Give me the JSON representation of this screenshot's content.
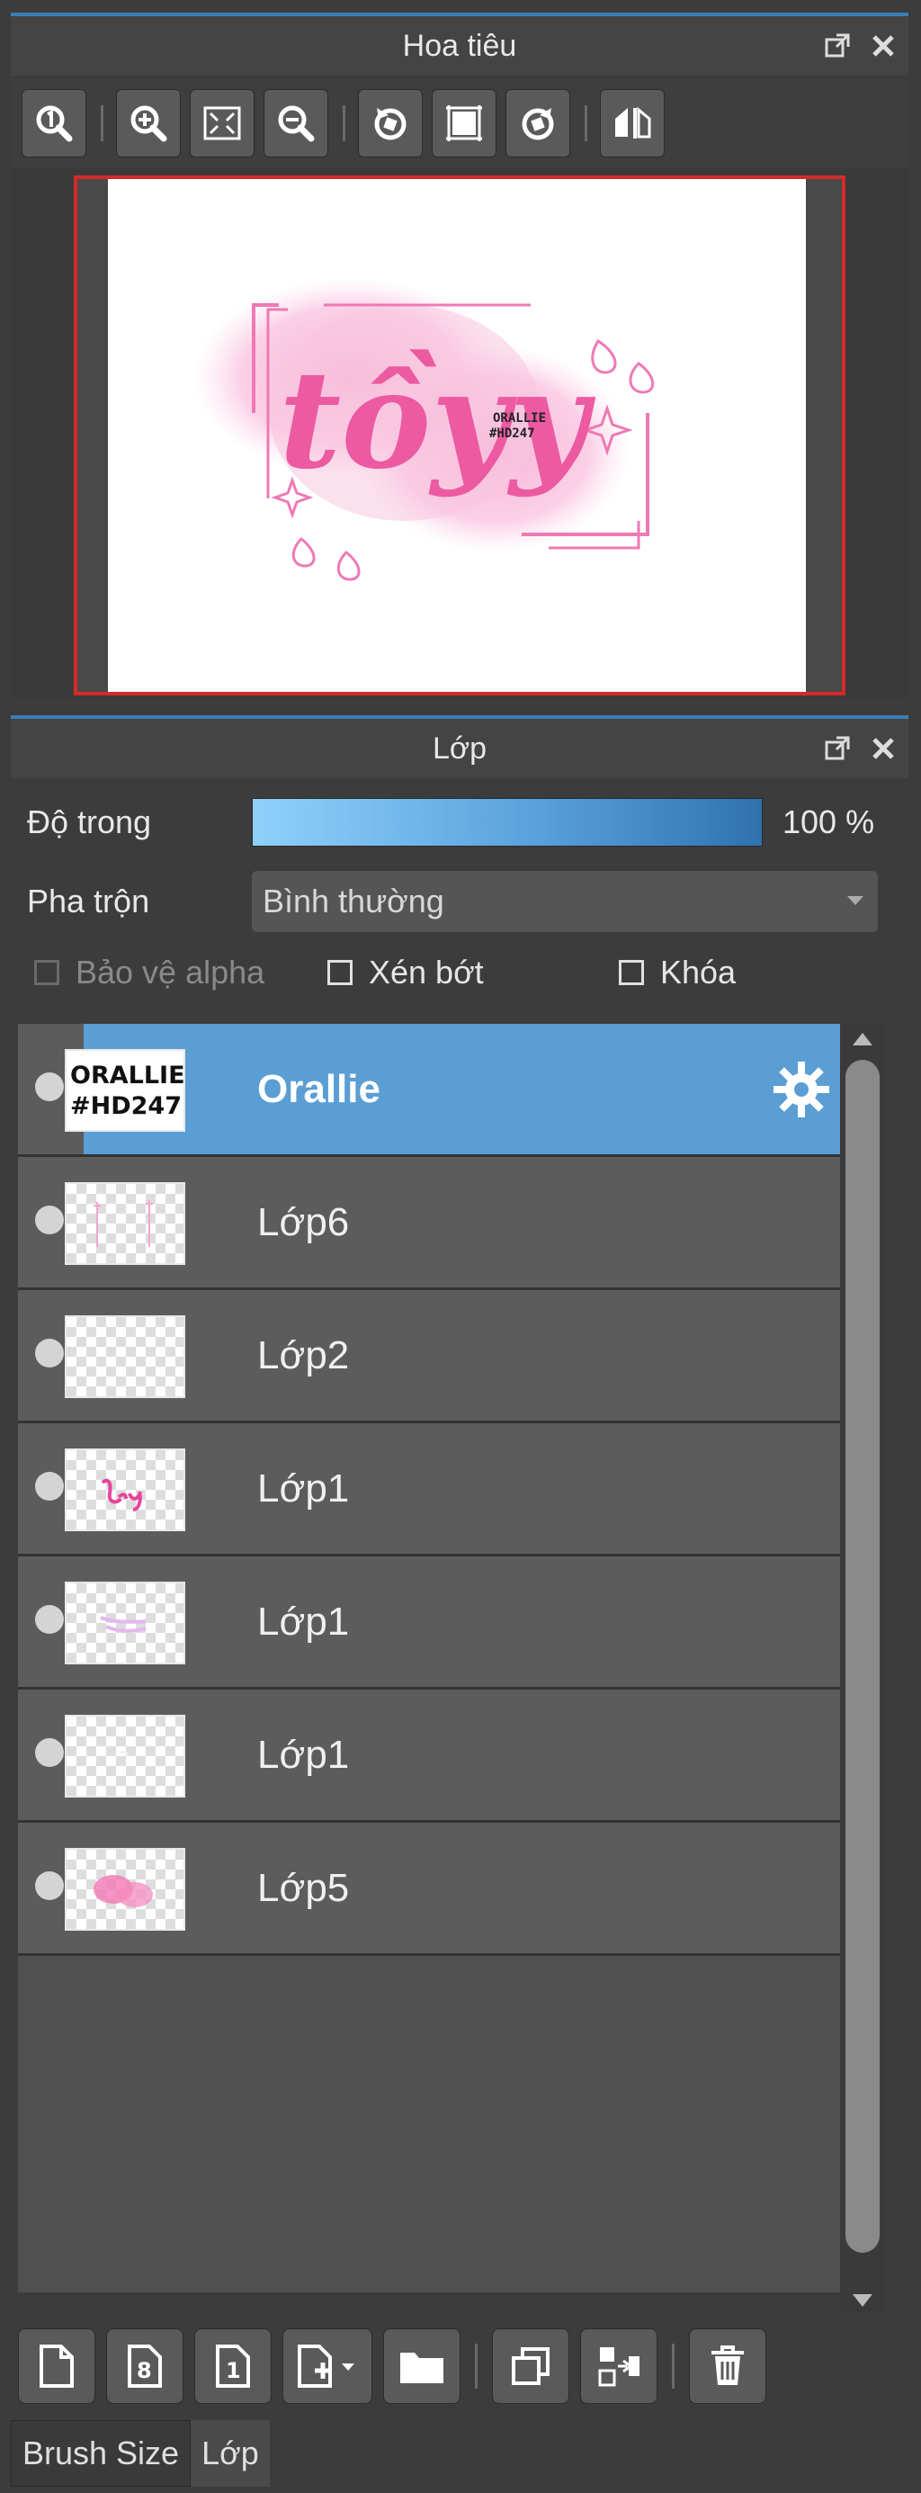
{
  "navigator": {
    "title": "Hoa tiêu"
  },
  "artwork": {
    "main_text": "tồyy",
    "small_text_line1": "ORALLIE",
    "small_text_line2": "#HD247"
  },
  "layers_panel": {
    "title": "Lớp",
    "opacity_label": "Độ trong",
    "opacity_value": "100 %",
    "opacity_level": 1.0,
    "blend_label": "Pha trộn",
    "blend_value": "Bình thường",
    "protect_alpha_label": "Bảo vệ alpha",
    "clip_label": "Xén bớt",
    "lock_label": "Khóa",
    "layers": [
      {
        "name": "Orallie",
        "thumb_text1": "ORALLIE",
        "thumb_text2": "#HD247",
        "active": true
      },
      {
        "name": "Lớp6"
      },
      {
        "name": "Lớp2"
      },
      {
        "name": "Lớp1"
      },
      {
        "name": "Lớp1"
      },
      {
        "name": "Lớp1"
      },
      {
        "name": "Lớp5"
      }
    ]
  },
  "accent_colors": {
    "header_line": "#3a7fb8",
    "selected_layer": "#5a9ed4",
    "canvas_border": "#d42a2a"
  },
  "bottom_tabs": [
    {
      "label": "Brush Size"
    },
    {
      "label": "Lớp"
    }
  ]
}
